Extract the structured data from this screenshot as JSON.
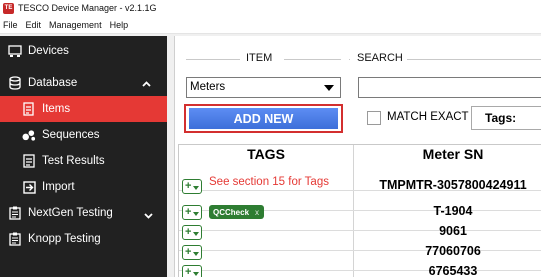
{
  "window": {
    "title": "TESCO Device Manager - v2.1.1G",
    "app_icon_text": "TE"
  },
  "menu": [
    "File",
    "Edit",
    "Management",
    "Help"
  ],
  "sidebar": {
    "items": [
      {
        "label": "Devices",
        "icon": "devices-icon"
      },
      {
        "label": "Database",
        "icon": "database-icon",
        "expanded": true
      },
      {
        "label": "Items",
        "icon": "items-icon",
        "active": true
      },
      {
        "label": "Sequences",
        "icon": "sequences-icon"
      },
      {
        "label": "Test Results",
        "icon": "test-results-icon"
      },
      {
        "label": "Import",
        "icon": "import-icon"
      },
      {
        "label": "NextGen Testing",
        "icon": "clipboard-icon"
      },
      {
        "label": "Knopp Testing",
        "icon": "clipboard-icon"
      }
    ]
  },
  "item_group": {
    "label": "ITEM",
    "selected": "Meters",
    "add_button": "ADD NEW"
  },
  "search_group": {
    "label": "SEARCH",
    "value": "",
    "match_exact": "MATCH EXACT",
    "checked": false,
    "tags_label": "Tags:"
  },
  "table": {
    "headers": [
      "TAGS",
      "Meter SN"
    ],
    "note": "See section 15 for Tags",
    "chip": {
      "label": "QCCheck",
      "close": "x"
    },
    "rows": [
      {
        "sn": "TMPMTR-3057800424911"
      },
      {
        "sn": "T-1904"
      },
      {
        "sn": "9061"
      },
      {
        "sn": "77060706"
      },
      {
        "sn": "6765433"
      }
    ]
  },
  "colors": {
    "sidebar_bg": "#212121",
    "active": "#e53935",
    "button_blue": "#4a7be6",
    "tag_green": "#2e7d32",
    "highlight_red": "#d32f2f"
  }
}
